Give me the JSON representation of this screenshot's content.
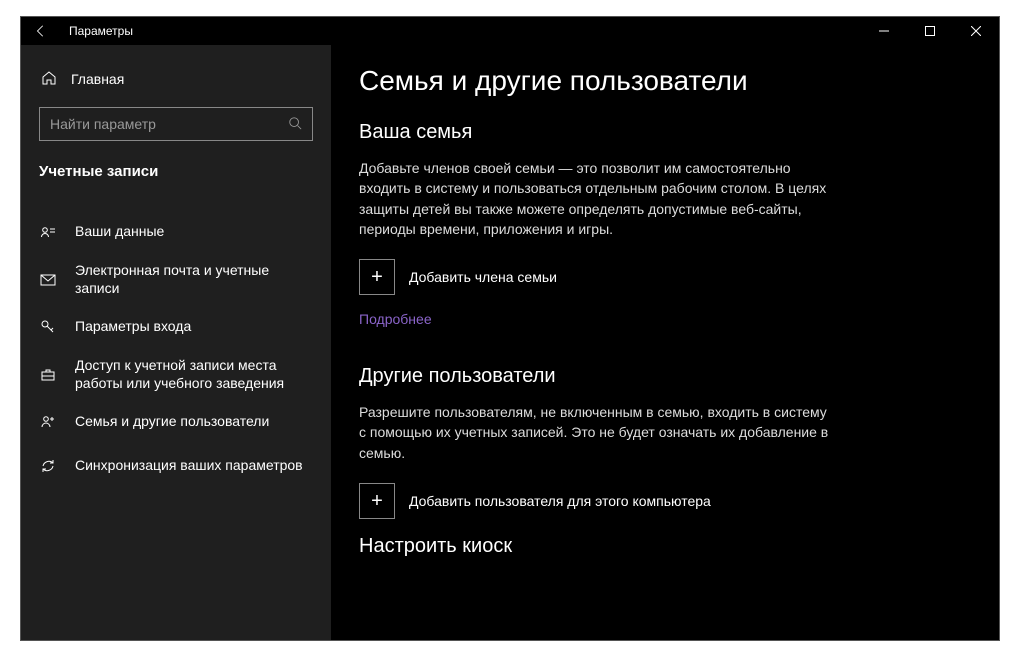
{
  "window": {
    "title": "Параметры"
  },
  "sidebar": {
    "home": "Главная",
    "search_placeholder": "Найти параметр",
    "section": "Учетные записи",
    "items": [
      "Ваши данные",
      "Электронная почта и учетные записи",
      "Параметры входа",
      "Доступ к учетной записи места работы или учебного заведения",
      "Семья и другие пользователи",
      "Синхронизация ваших параметров"
    ]
  },
  "main": {
    "title": "Семья и другие пользователи",
    "family": {
      "heading": "Ваша семья",
      "desc": "Добавьте членов своей семьи — это позволит им самостоятельно входить в систему и пользоваться отдельным рабочим столом. В целях защиты детей вы также можете определять допустимые веб-сайты, периоды времени, приложения и игры.",
      "add": "Добавить члена семьи",
      "more": "Подробнее"
    },
    "others": {
      "heading": "Другие пользователи",
      "desc": "Разрешите пользователям, не включенным в семью, входить в систему с помощью их учетных записей. Это не будет означать их добавление в семью.",
      "add": "Добавить пользователя для этого компьютера"
    },
    "kiosk": {
      "heading": "Настроить киоск"
    }
  }
}
